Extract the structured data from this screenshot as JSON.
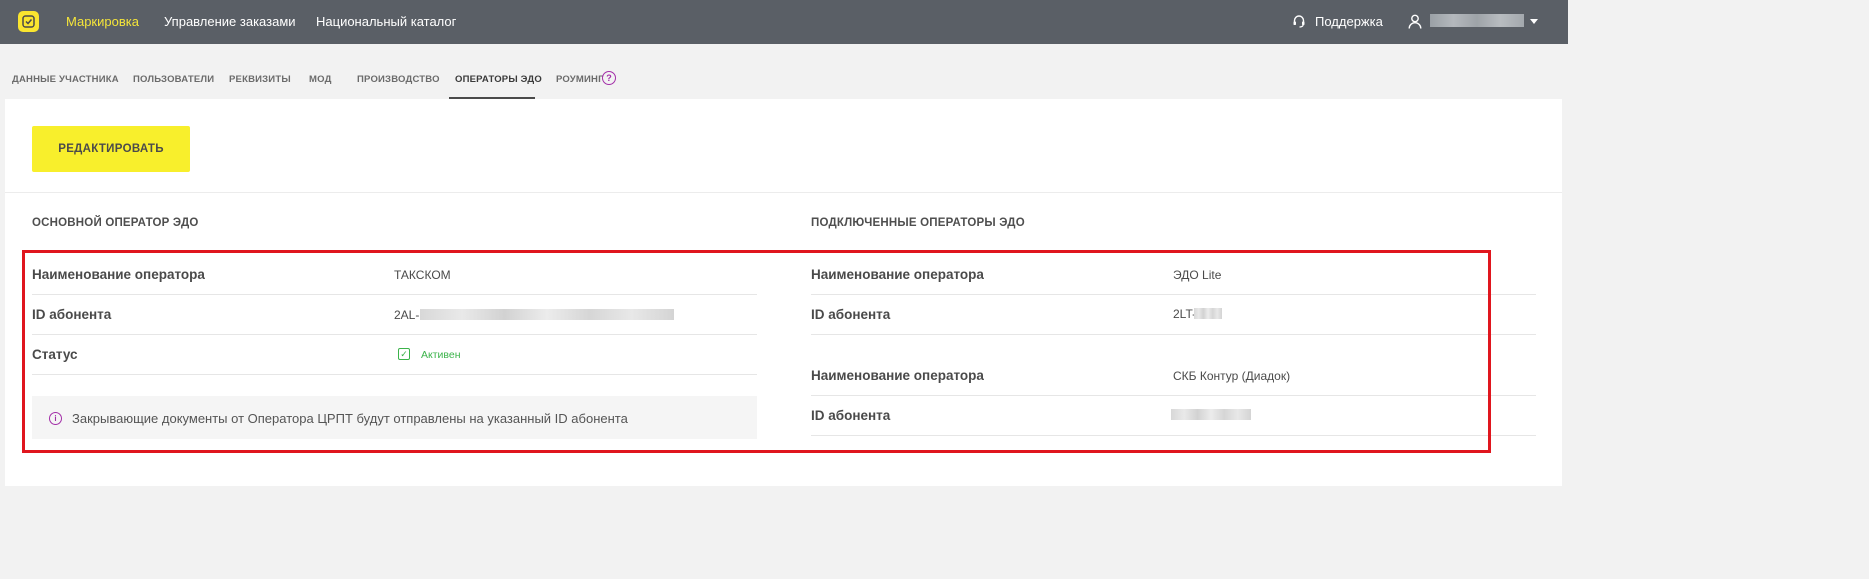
{
  "topbar": {
    "nav": [
      "Маркировка",
      "Управление заказами",
      "Национальный каталог"
    ],
    "support": "Поддержка"
  },
  "tabs": [
    "ДАННЫЕ УЧАСТНИКА",
    "ПОЛЬЗОВАТЕЛИ",
    "РЕКВИЗИТЫ",
    "МОД",
    "ПРОИЗВОДСТВО",
    "ОПЕРАТОРЫ ЭДО",
    "РОУМИНГ"
  ],
  "help_glyph": "?",
  "actions": {
    "edit": "РЕДАКТИРОВАТЬ"
  },
  "primary": {
    "title": "ОСНОВНОЙ ОПЕРАТОР ЭДО",
    "operator_label": "Наименование оператора",
    "operator_value": "ТАКСКОМ",
    "id_label": "ID абонента",
    "id_prefix": "2AL-",
    "status_label": "Статус",
    "status_value": "Активен",
    "info_glyph": "i",
    "info_text": "Закрывающие документы от Оператора ЦРПТ будут отправлены на указанный ID абонента"
  },
  "connected": {
    "title": "ПОДКЛЮЧЕННЫЕ ОПЕРАТОРЫ ЭДО",
    "operators": [
      {
        "operator_label": "Наименование оператора",
        "operator_value": "ЭДО Lite",
        "id_label": "ID абонента",
        "id_prefix": "2LT-"
      },
      {
        "operator_label": "Наименование оператора",
        "operator_value": "СКБ Контур (Диадок)",
        "id_label": "ID абонента",
        "id_prefix": ""
      }
    ]
  },
  "colors": {
    "topbar": "#5a5f66",
    "active_nav": "#f5e53a",
    "button": "#f8ef2c",
    "status_green": "#3bb34a",
    "accent_purple": "#a32fa8",
    "highlight_red": "#e0161e"
  },
  "icons": {
    "logo": "logo-icon",
    "support": "headset-icon",
    "user": "user-icon",
    "dropdown": "chevron-down-icon",
    "help": "help-icon",
    "status": "checkbox-checked-icon",
    "info": "info-icon"
  }
}
